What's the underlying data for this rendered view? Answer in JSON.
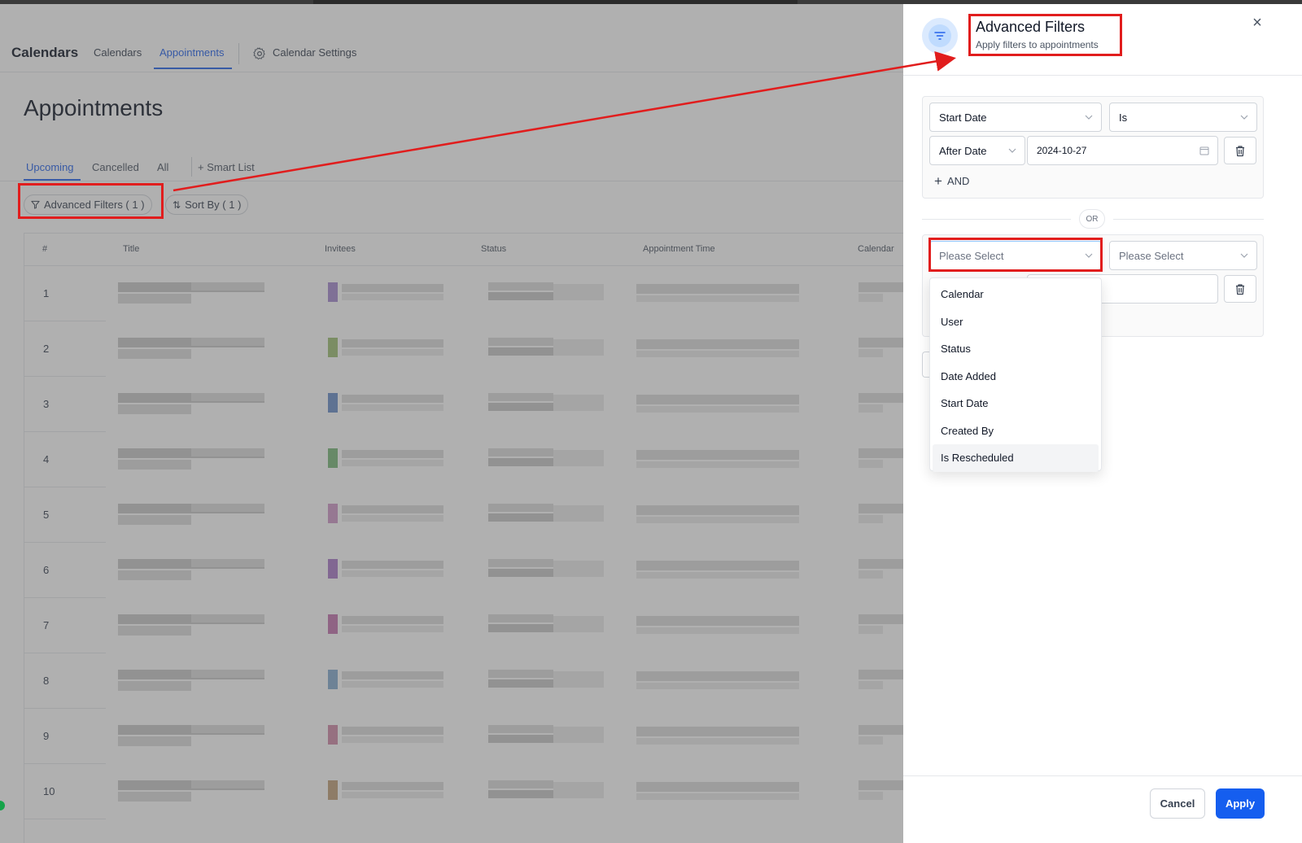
{
  "app": {
    "brand": "Calendars",
    "nav": {
      "calendars": "Calendars",
      "appointments": "Appointments",
      "settings": "Calendar Settings"
    },
    "page_title": "Appointments",
    "subtabs": {
      "upcoming": "Upcoming",
      "cancelled": "Cancelled",
      "all": "All",
      "smart_list": "+ Smart List"
    },
    "advanced_filters_pill": "Advanced Filters ( 1 )",
    "sort_by_pill": "Sort By ( 1 )",
    "table": {
      "headers": {
        "num": "#",
        "title": "Title",
        "invitees": "Invitees",
        "status": "Status",
        "time": "Appointment Time",
        "calendar": "Calendar"
      },
      "rows": [
        "1",
        "2",
        "3",
        "4",
        "5",
        "6",
        "7",
        "8",
        "9",
        "10"
      ],
      "invitee_colors": [
        "#a78bd0",
        "#9fbf75",
        "#6b8fc9",
        "#7ab87a",
        "#cf9ac9",
        "#a97ac9",
        "#c476b0",
        "#86acd0",
        "#d08aa8",
        "#c2a07a"
      ]
    }
  },
  "drawer": {
    "title": "Advanced Filters",
    "subtitle": "Apply filters to appointments",
    "group1": {
      "field": "Start Date",
      "operator": "Is",
      "condition": "After Date",
      "date_value": "2024-10-27",
      "and_label": "AND"
    },
    "or_label": "OR",
    "group2": {
      "field_placeholder": "Please Select",
      "operator_placeholder": "Please Select"
    },
    "dropdown_options": [
      "Calendar",
      "User",
      "Status",
      "Date Added",
      "Start Date",
      "Created By",
      "Is Rescheduled"
    ],
    "cancel": "Cancel",
    "apply": "Apply"
  },
  "colors": {
    "accent": "#2563eb",
    "apply": "#155eef",
    "annotation": "#e11d1d"
  }
}
